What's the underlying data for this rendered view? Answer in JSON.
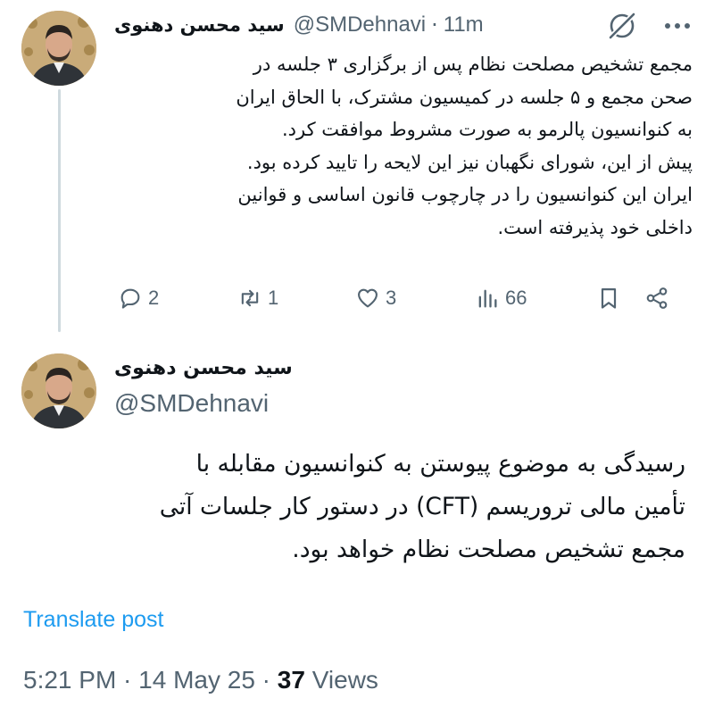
{
  "tweet1": {
    "display_name": "سید محسن دهنوی",
    "handle": "@SMDehnavi",
    "separator": "·",
    "time": "11m",
    "lines": [
      "مجمع تشخیص مصلحت نظام پس از برگزاری ۳ جلسه در",
      "صحن مجمع و ۵ جلسه در کمیسیون مشترک، با الحاق ایران",
      "به کنوانسیون پالرمو به صورت مشروط موافقت کرد.",
      "پیش از این، شورای نگهبان نیز این لایحه را تایید کرده بود.",
      "ایران این کنوانسیون را در چارچوب قانون اساسی و قوانین",
      "داخلی خود پذیرفته است."
    ],
    "actions": {
      "replies": "2",
      "reposts": "1",
      "likes": "3",
      "views": "66"
    }
  },
  "tweet2": {
    "display_name": "سید محسن دهنوی",
    "handle": "@SMDehnavi",
    "lines": [
      "رسیدگی به موضوع پیوستن به کنوانسیون مقابله با",
      "تأمین مالی تروریسم (CFT) در دستور کار جلسات آتی",
      "مجمع تشخیص مصلحت نظام خواهد بود."
    ],
    "translate_label": "Translate post",
    "timestamp": "5:21 PM · 14 May 25 · ",
    "views_count": "37",
    "views_label": " Views"
  },
  "icons": {
    "grok": "grok-icon",
    "more": "more-icon",
    "reply": "reply-icon",
    "repost": "repost-icon",
    "like": "like-icon",
    "views": "views-icon",
    "bookmark": "bookmark-icon",
    "share": "share-icon"
  },
  "colors": {
    "text": "#0f1419",
    "secondary": "#536471",
    "link": "#1d9bf0",
    "thread_line": "#cfd9de"
  }
}
